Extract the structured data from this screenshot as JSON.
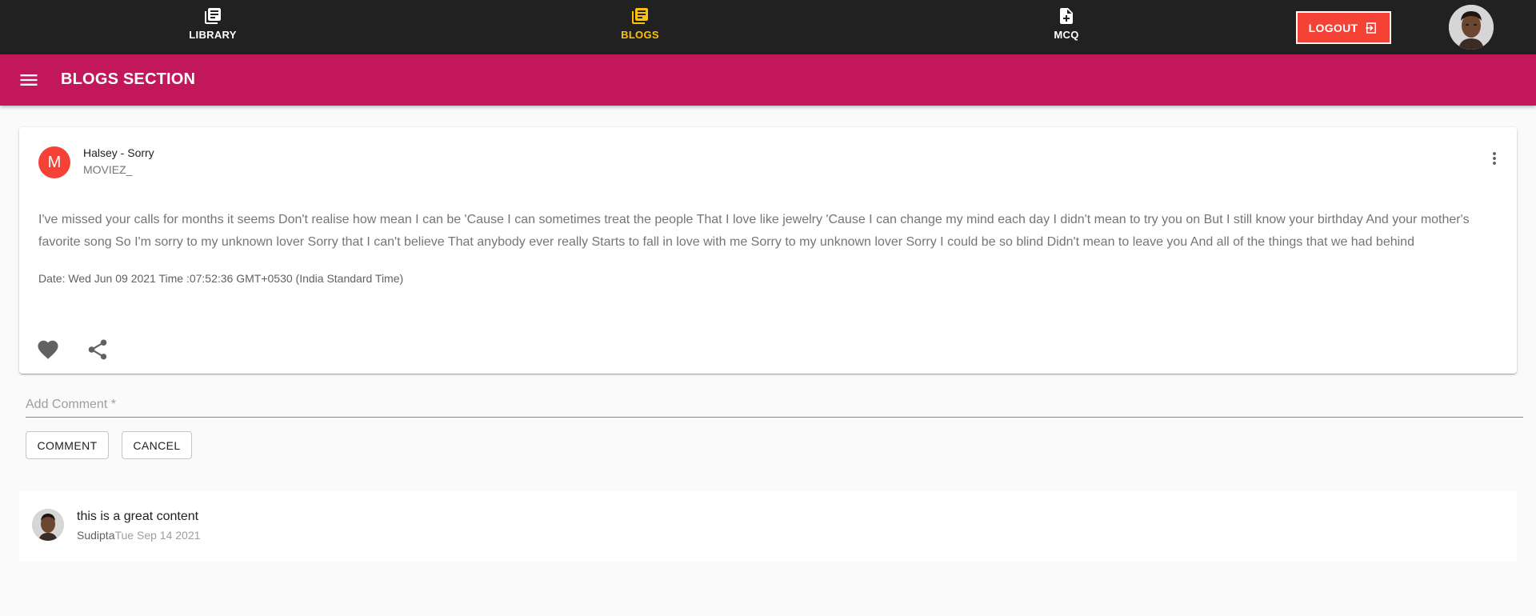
{
  "nav": {
    "items": [
      {
        "label": "LIBRARY",
        "icon": "library-books-icon"
      },
      {
        "label": "BLOGS",
        "icon": "library-books-icon",
        "active": true
      },
      {
        "label": "MCQ",
        "icon": "note-add-icon"
      }
    ],
    "logout_label": "LOGOUT",
    "active_color": "#ffc107"
  },
  "appbar": {
    "title": "BLOGS SECTION",
    "color": "#c2185b"
  },
  "post": {
    "avatar_letter": "M",
    "avatar_color": "#f44336",
    "title": "Halsey - Sorry",
    "author": "MOVIEZ_",
    "body": "I've missed your calls for months it seems Don't realise how mean I can be 'Cause I can sometimes treat the people That I love like jewelry 'Cause I can change my mind each day I didn't mean to try you on But I still know your birthday And your mother's favorite song So I'm sorry to my unknown lover Sorry that I can't believe That anybody ever really Starts to fall in love with me Sorry to my unknown lover Sorry I could be so blind Didn't mean to leave you And all of the things that we had behind",
    "date": "Date: Wed Jun 09 2021 Time :07:52:36 GMT+0530 (India Standard Time)"
  },
  "comment_form": {
    "placeholder": "Add Comment *",
    "value": "",
    "submit_label": "COMMENT",
    "cancel_label": "CANCEL"
  },
  "comments": [
    {
      "text": "this is a great content",
      "user": "Sudipta",
      "date": "Tue Sep 14 2021"
    }
  ]
}
